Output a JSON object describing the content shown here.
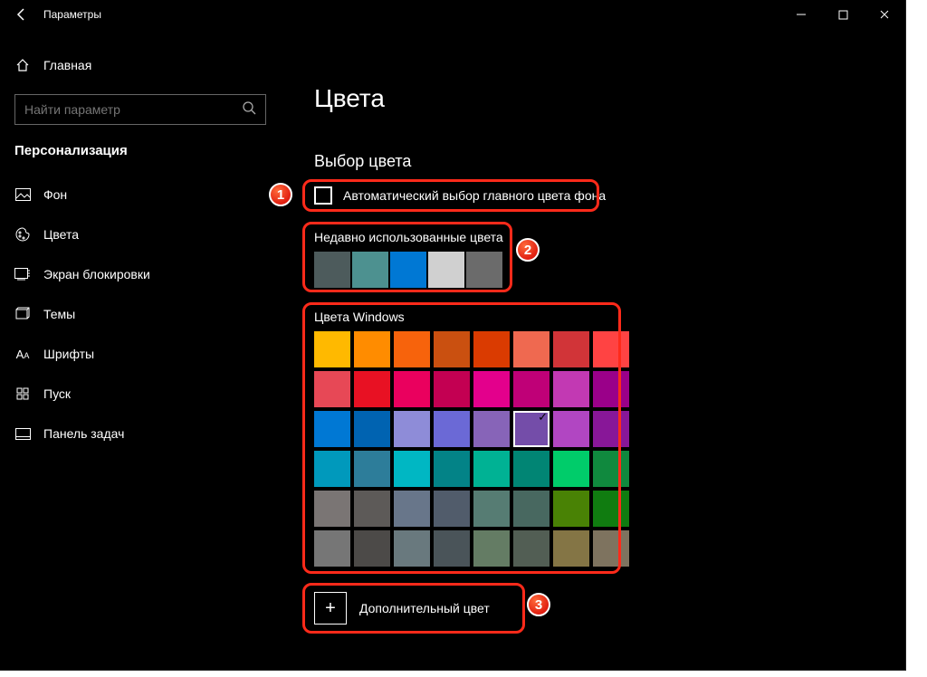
{
  "app_title": "Параметры",
  "search_placeholder": "Найти параметр",
  "home": "Главная",
  "section": "Персонализация",
  "nav": {
    "bg": "Фон",
    "colors": "Цвета",
    "lock": "Экран блокировки",
    "themes": "Темы",
    "fonts": "Шрифты",
    "start": "Пуск",
    "taskbar": "Панель задач"
  },
  "page": {
    "title": "Цвета",
    "subheading": "Выбор цвета",
    "auto_accent": "Автоматический выбор главного цвета фона",
    "recent_title": "Недавно использованные цвета",
    "windows_colors_title": "Цвета Windows",
    "custom_color": "Дополнительный цвет"
  },
  "recent_colors": [
    "#4d5b5c",
    "#4d9190",
    "#0078d4",
    "#d0d0d0",
    "#6b6b6b"
  ],
  "palette": [
    [
      "#ffb900",
      "#ff8c00",
      "#f7630c",
      "#ca5010",
      "#da3b01",
      "#ef6950",
      "#d13438",
      "#ff4343"
    ],
    [
      "#e74856",
      "#e81123",
      "#ea005e",
      "#c30052",
      "#e3008c",
      "#bf0077",
      "#c239b3",
      "#9a0089"
    ],
    [
      "#0078d4",
      "#0063b1",
      "#8e8cd8",
      "#6b69d6",
      "#8764b8",
      "#744da9",
      "#b146c2",
      "#881798"
    ],
    [
      "#0099bc",
      "#2d7d9a",
      "#00b7c3",
      "#038387",
      "#00b294",
      "#018574",
      "#00cc6a",
      "#10893e"
    ],
    [
      "#7a7574",
      "#5d5a58",
      "#68768a",
      "#515c6b",
      "#567c73",
      "#486860",
      "#498205",
      "#107c10"
    ],
    [
      "#767676",
      "#4c4a48",
      "#69797e",
      "#4a5459",
      "#647c64",
      "#525e54",
      "#847545",
      "#7e735f"
    ]
  ],
  "selected_palette": {
    "row": 2,
    "col": 5
  },
  "badges": {
    "b1": "1",
    "b2": "2",
    "b3": "3"
  }
}
